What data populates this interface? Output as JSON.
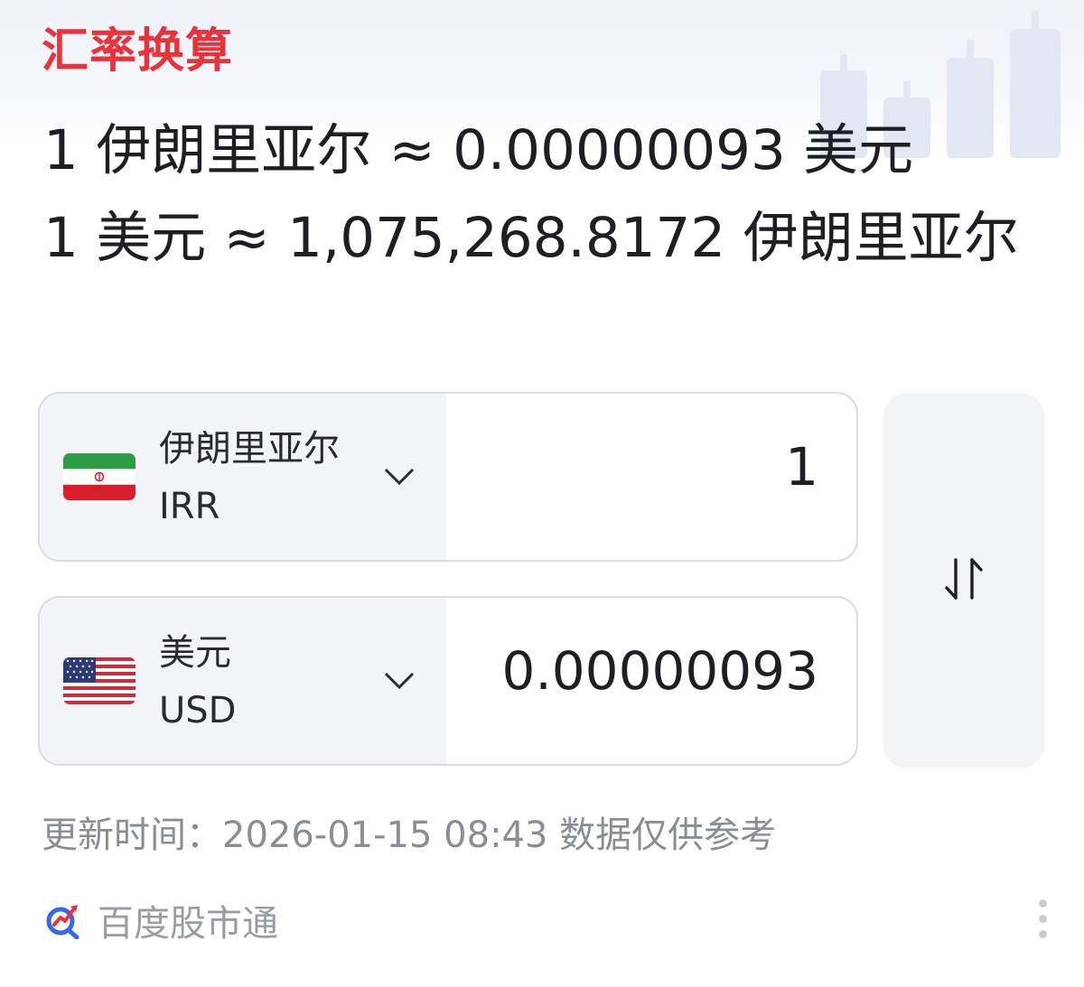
{
  "header": {
    "title": "汇率换算"
  },
  "rates": {
    "line1": "1 伊朗里亚尔 ≈ 0.00000093 美元",
    "line2": "1 美元 ≈ 1,075,268.8172 伊朗里亚尔"
  },
  "from": {
    "name": "伊朗里亚尔",
    "code": "IRR",
    "flag": "iran-flag",
    "amount": "1"
  },
  "to": {
    "name": "美元",
    "code": "USD",
    "flag": "us-flag",
    "amount": "0.00000093"
  },
  "swap": {
    "icon": "swap-arrows-icon"
  },
  "footer": {
    "update_text": "更新时间：2026-01-15 08:43 数据仅供参考",
    "brand_name": "百度股市通",
    "brand_icon": "baidu-stock-logo-icon",
    "more_icon": "more-vertical-icon"
  },
  "colors": {
    "title": "#e8323c",
    "text": "#1e1f24",
    "muted": "#8a8d96",
    "panel": "#f3f4f8"
  }
}
